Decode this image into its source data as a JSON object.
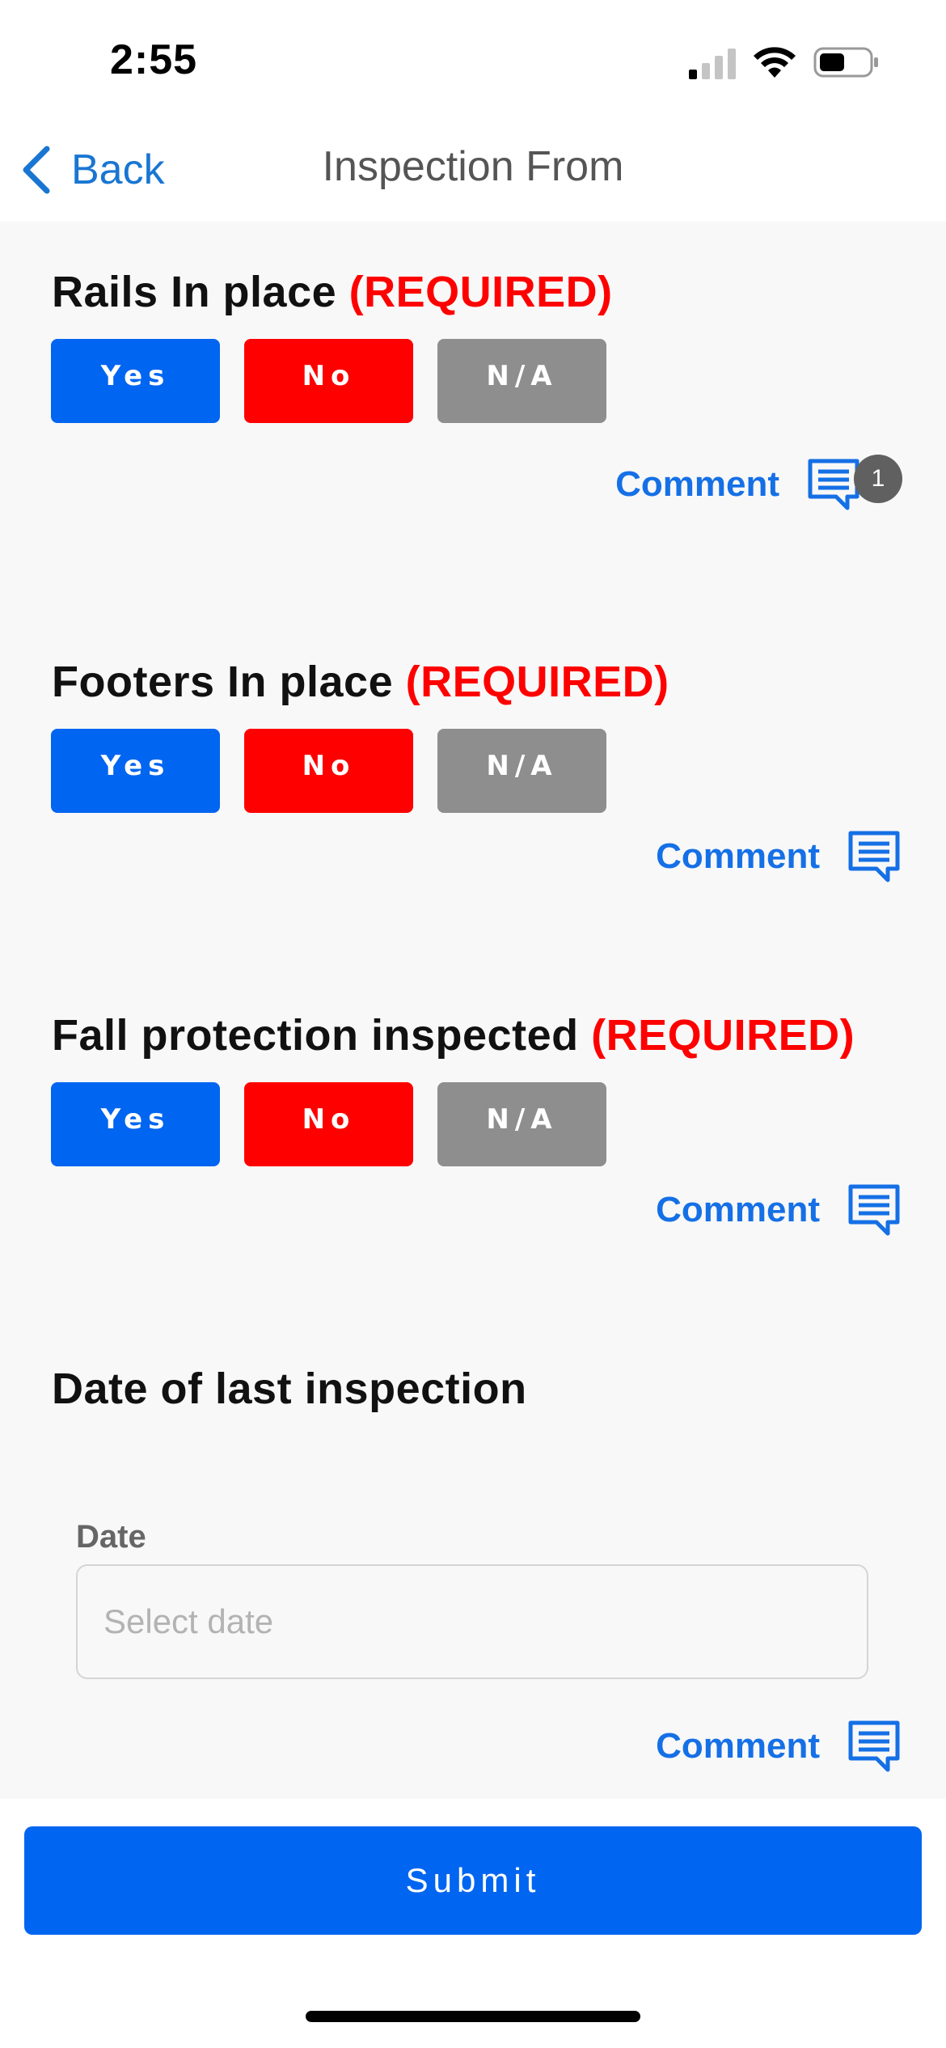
{
  "status_bar": {
    "time": "2:55",
    "signal_icon": "cellular-signal-icon",
    "wifi_icon": "wifi-icon",
    "battery_icon": "battery-icon"
  },
  "nav": {
    "back_label": "Back",
    "back_icon": "chevron-left-icon",
    "title": "Inspection  From"
  },
  "questions": [
    {
      "label": "Rails In place",
      "required": "(REQUIRED)",
      "options": [
        "Yes",
        "No",
        "N/A"
      ],
      "comment_label": "Comment",
      "comment_count": "1"
    },
    {
      "label": "Footers In place",
      "required": "(REQUIRED)",
      "options": [
        "Yes",
        "No",
        "N/A"
      ],
      "comment_label": "Comment"
    },
    {
      "label": "Fall protection inspected",
      "required": "(REQUIRED)",
      "options": [
        "Yes",
        "No",
        "N/A"
      ],
      "comment_label": "Comment"
    }
  ],
  "date_question": {
    "label": "Date of last inspection",
    "field_label": "Date",
    "placeholder": "Select date",
    "value": "",
    "comment_label": "Comment"
  },
  "submit_label": "Submit",
  "colors": {
    "yes": "#0065f0",
    "no": "#ff0000",
    "na": "#8e8e8e",
    "required": "#ff0000",
    "comment": "#1570e6",
    "background": "#f8f8f8"
  }
}
